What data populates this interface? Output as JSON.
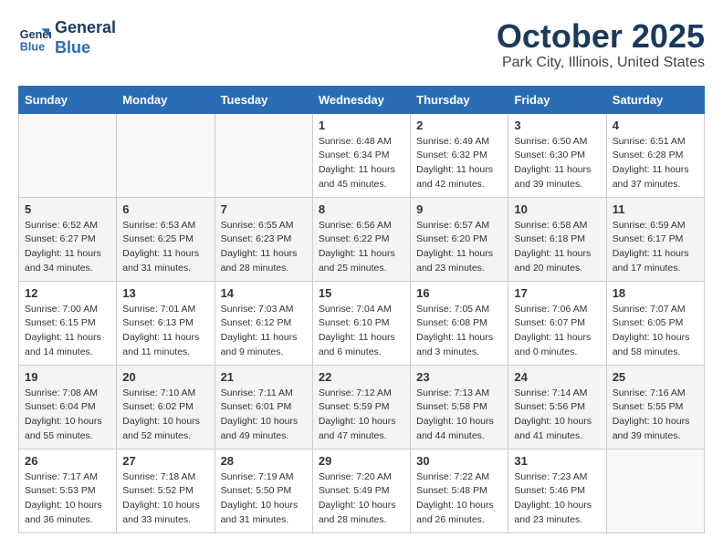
{
  "header": {
    "logo_line1": "General",
    "logo_line2": "Blue",
    "month": "October 2025",
    "location": "Park City, Illinois, United States"
  },
  "weekdays": [
    "Sunday",
    "Monday",
    "Tuesday",
    "Wednesday",
    "Thursday",
    "Friday",
    "Saturday"
  ],
  "weeks": [
    [
      {
        "day": "",
        "info": ""
      },
      {
        "day": "",
        "info": ""
      },
      {
        "day": "",
        "info": ""
      },
      {
        "day": "1",
        "info": "Sunrise: 6:48 AM\nSunset: 6:34 PM\nDaylight: 11 hours and 45 minutes."
      },
      {
        "day": "2",
        "info": "Sunrise: 6:49 AM\nSunset: 6:32 PM\nDaylight: 11 hours and 42 minutes."
      },
      {
        "day": "3",
        "info": "Sunrise: 6:50 AM\nSunset: 6:30 PM\nDaylight: 11 hours and 39 minutes."
      },
      {
        "day": "4",
        "info": "Sunrise: 6:51 AM\nSunset: 6:28 PM\nDaylight: 11 hours and 37 minutes."
      }
    ],
    [
      {
        "day": "5",
        "info": "Sunrise: 6:52 AM\nSunset: 6:27 PM\nDaylight: 11 hours and 34 minutes."
      },
      {
        "day": "6",
        "info": "Sunrise: 6:53 AM\nSunset: 6:25 PM\nDaylight: 11 hours and 31 minutes."
      },
      {
        "day": "7",
        "info": "Sunrise: 6:55 AM\nSunset: 6:23 PM\nDaylight: 11 hours and 28 minutes."
      },
      {
        "day": "8",
        "info": "Sunrise: 6:56 AM\nSunset: 6:22 PM\nDaylight: 11 hours and 25 minutes."
      },
      {
        "day": "9",
        "info": "Sunrise: 6:57 AM\nSunset: 6:20 PM\nDaylight: 11 hours and 23 minutes."
      },
      {
        "day": "10",
        "info": "Sunrise: 6:58 AM\nSunset: 6:18 PM\nDaylight: 11 hours and 20 minutes."
      },
      {
        "day": "11",
        "info": "Sunrise: 6:59 AM\nSunset: 6:17 PM\nDaylight: 11 hours and 17 minutes."
      }
    ],
    [
      {
        "day": "12",
        "info": "Sunrise: 7:00 AM\nSunset: 6:15 PM\nDaylight: 11 hours and 14 minutes."
      },
      {
        "day": "13",
        "info": "Sunrise: 7:01 AM\nSunset: 6:13 PM\nDaylight: 11 hours and 11 minutes."
      },
      {
        "day": "14",
        "info": "Sunrise: 7:03 AM\nSunset: 6:12 PM\nDaylight: 11 hours and 9 minutes."
      },
      {
        "day": "15",
        "info": "Sunrise: 7:04 AM\nSunset: 6:10 PM\nDaylight: 11 hours and 6 minutes."
      },
      {
        "day": "16",
        "info": "Sunrise: 7:05 AM\nSunset: 6:08 PM\nDaylight: 11 hours and 3 minutes."
      },
      {
        "day": "17",
        "info": "Sunrise: 7:06 AM\nSunset: 6:07 PM\nDaylight: 11 hours and 0 minutes."
      },
      {
        "day": "18",
        "info": "Sunrise: 7:07 AM\nSunset: 6:05 PM\nDaylight: 10 hours and 58 minutes."
      }
    ],
    [
      {
        "day": "19",
        "info": "Sunrise: 7:08 AM\nSunset: 6:04 PM\nDaylight: 10 hours and 55 minutes."
      },
      {
        "day": "20",
        "info": "Sunrise: 7:10 AM\nSunset: 6:02 PM\nDaylight: 10 hours and 52 minutes."
      },
      {
        "day": "21",
        "info": "Sunrise: 7:11 AM\nSunset: 6:01 PM\nDaylight: 10 hours and 49 minutes."
      },
      {
        "day": "22",
        "info": "Sunrise: 7:12 AM\nSunset: 5:59 PM\nDaylight: 10 hours and 47 minutes."
      },
      {
        "day": "23",
        "info": "Sunrise: 7:13 AM\nSunset: 5:58 PM\nDaylight: 10 hours and 44 minutes."
      },
      {
        "day": "24",
        "info": "Sunrise: 7:14 AM\nSunset: 5:56 PM\nDaylight: 10 hours and 41 minutes."
      },
      {
        "day": "25",
        "info": "Sunrise: 7:16 AM\nSunset: 5:55 PM\nDaylight: 10 hours and 39 minutes."
      }
    ],
    [
      {
        "day": "26",
        "info": "Sunrise: 7:17 AM\nSunset: 5:53 PM\nDaylight: 10 hours and 36 minutes."
      },
      {
        "day": "27",
        "info": "Sunrise: 7:18 AM\nSunset: 5:52 PM\nDaylight: 10 hours and 33 minutes."
      },
      {
        "day": "28",
        "info": "Sunrise: 7:19 AM\nSunset: 5:50 PM\nDaylight: 10 hours and 31 minutes."
      },
      {
        "day": "29",
        "info": "Sunrise: 7:20 AM\nSunset: 5:49 PM\nDaylight: 10 hours and 28 minutes."
      },
      {
        "day": "30",
        "info": "Sunrise: 7:22 AM\nSunset: 5:48 PM\nDaylight: 10 hours and 26 minutes."
      },
      {
        "day": "31",
        "info": "Sunrise: 7:23 AM\nSunset: 5:46 PM\nDaylight: 10 hours and 23 minutes."
      },
      {
        "day": "",
        "info": ""
      }
    ]
  ]
}
